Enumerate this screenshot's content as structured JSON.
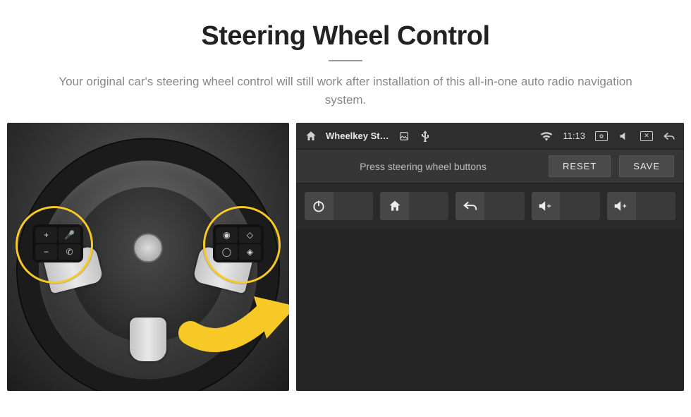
{
  "header": {
    "title": "Steering Wheel Control",
    "subtitle": "Your original car's steering wheel control will still work after installation of this all-in-one auto radio navigation system."
  },
  "wheel": {
    "left_pad": {
      "tl": "+",
      "tr": "🎤",
      "bl": "−",
      "br": "✆"
    },
    "right_pad": {
      "tl": "◉",
      "tr": "◇",
      "bl": "◯",
      "br": "◈"
    }
  },
  "statusbar": {
    "app_title": "Wheelkey St…",
    "time": "11:13",
    "icons": {
      "home": "home-icon",
      "image": "image-icon",
      "usb": "usb-icon",
      "wifi": "wifi-icon",
      "cast": "cast-icon",
      "mute": "mute-icon",
      "close": "close-icon",
      "back": "back-icon"
    }
  },
  "toolbar": {
    "instruction": "Press steering wheel buttons",
    "reset_label": "RESET",
    "save_label": "SAVE"
  },
  "slots": [
    {
      "icon": "power-icon"
    },
    {
      "icon": "home-icon"
    },
    {
      "icon": "undo-icon"
    },
    {
      "icon": "volume-up-icon"
    },
    {
      "icon": "volume-up-icon"
    }
  ]
}
